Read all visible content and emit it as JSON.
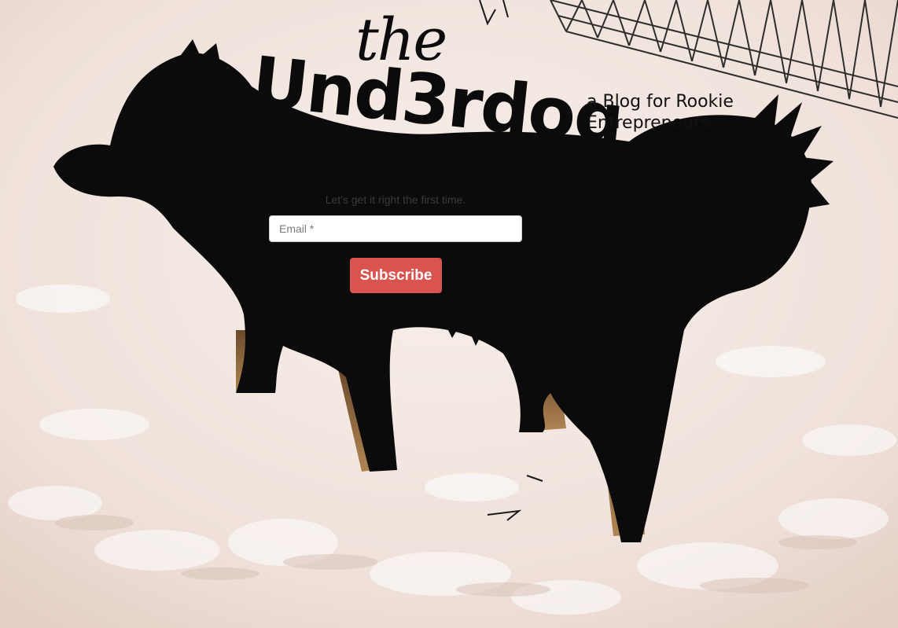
{
  "logo": {
    "word_the": "the",
    "word_main": "Und3rdog",
    "tagline_line1": "a Blog for Rookie",
    "tagline_line2": "Entrepreneurs"
  },
  "signup": {
    "headline": "Let's get it right the first time.",
    "email_placeholder": "Email *",
    "subscribe_label": "Subscribe"
  },
  "colors": {
    "button": "#d9534f",
    "snow": "#f2e6e0",
    "dog": "#0b0b0b"
  }
}
